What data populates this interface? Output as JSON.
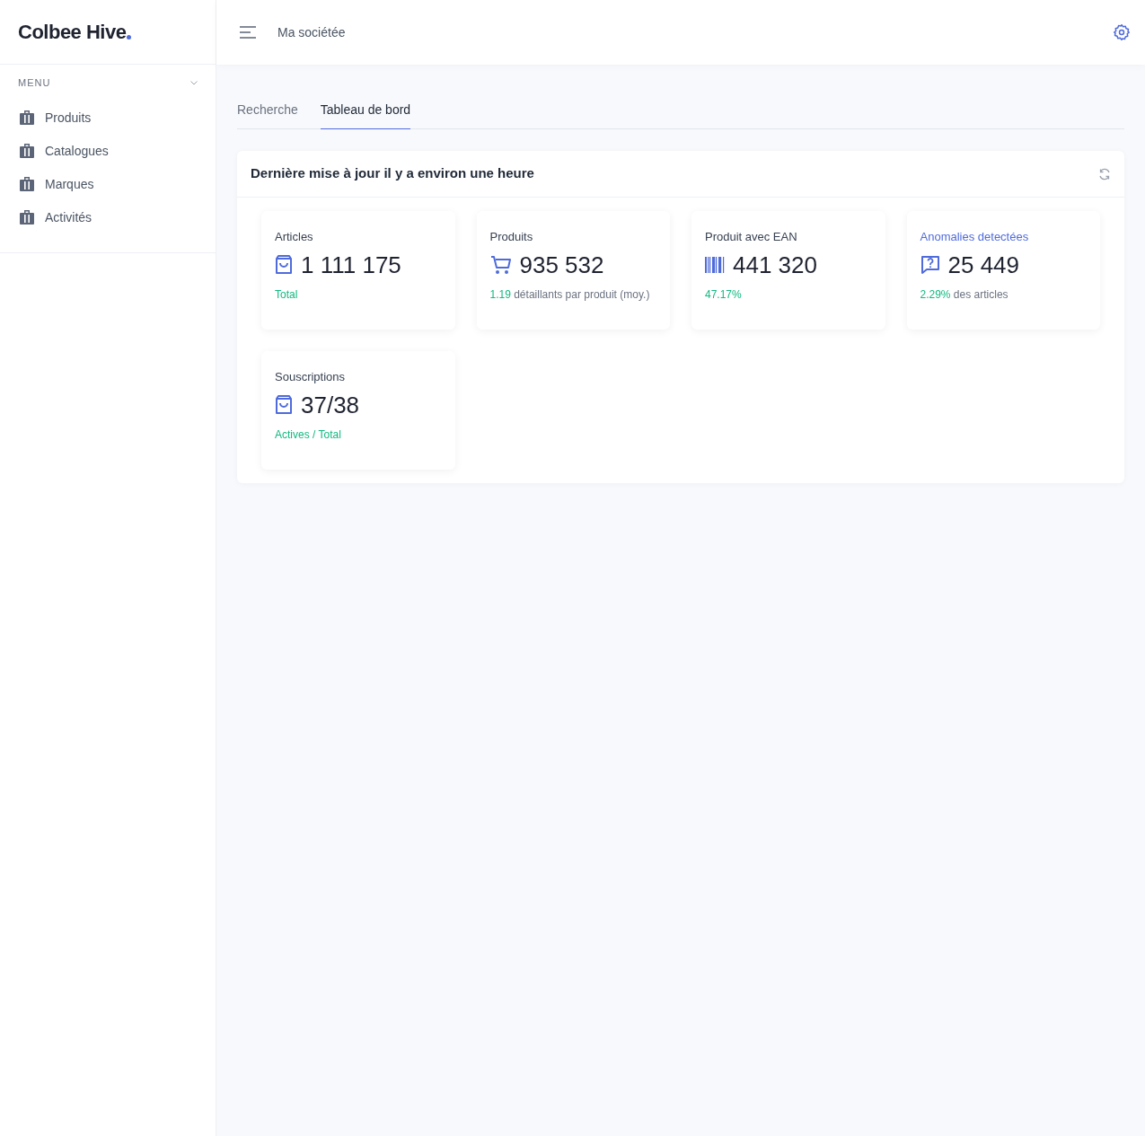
{
  "sidebar": {
    "logo": "Colbee Hive",
    "section": "MENU",
    "section_expanded": true,
    "items": [
      {
        "label": "Produits"
      },
      {
        "label": "Catalogues"
      },
      {
        "label": "Marques"
      },
      {
        "label": "Activités"
      }
    ]
  },
  "header": {
    "company": "Ma sociétée"
  },
  "tabs": [
    {
      "label": "Recherche",
      "selected": false
    },
    {
      "label": "Tableau de bord",
      "selected": true
    }
  ],
  "panel": {
    "title": "Dernière mise à jour il y a environ une heure",
    "cards": [
      {
        "title": "Articles",
        "title_link": false,
        "kind": "bag",
        "value": "1 111 175",
        "note_highlight": "Total"
      },
      {
        "title": "Produits",
        "title_link": false,
        "kind": "cart",
        "value": "935 532",
        "note_highlight": "1.19",
        "note_rest": "détaillants par produit (moy.)"
      },
      {
        "title": "Produit avec EAN",
        "title_link": false,
        "kind": "barcode",
        "value": "441 320",
        "note_highlight": "47.17%"
      },
      {
        "title": "Anomalies detectées",
        "title_link": true,
        "kind": "question",
        "value": "25 449",
        "note_highlight": "2.29%",
        "note_rest": "des articles"
      },
      {
        "title": "Souscriptions",
        "title_link": false,
        "kind": "bag",
        "value": "37/38",
        "note_highlight": "Actives / Total"
      }
    ]
  }
}
